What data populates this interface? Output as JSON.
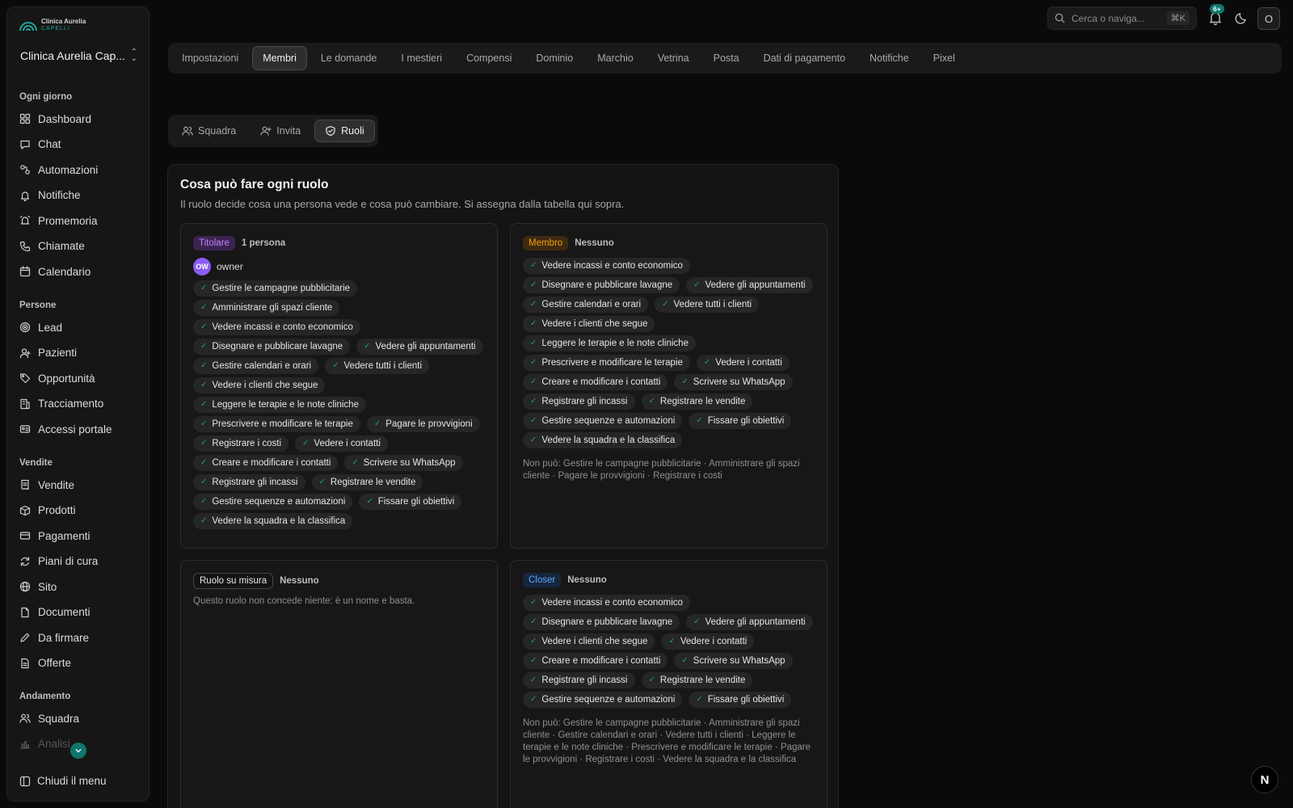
{
  "brand": {
    "line1": "Clinica Aurelia",
    "line2": "CAPELLI"
  },
  "workspace": {
    "name": "Clinica Aurelia Cap..."
  },
  "sidebar": {
    "sections": [
      {
        "label": "Ogni giorno",
        "items": [
          {
            "label": "Dashboard",
            "icon": "dashboard-icon"
          },
          {
            "label": "Chat",
            "icon": "chat-icon"
          },
          {
            "label": "Automazioni",
            "icon": "automation-icon"
          },
          {
            "label": "Notifiche",
            "icon": "bell-icon"
          },
          {
            "label": "Promemoria",
            "icon": "alarm-icon"
          },
          {
            "label": "Chiamate",
            "icon": "phone-icon"
          },
          {
            "label": "Calendario",
            "icon": "calendar-icon"
          }
        ]
      },
      {
        "label": "Persone",
        "items": [
          {
            "label": "Lead",
            "icon": "target-icon"
          },
          {
            "label": "Pazienti",
            "icon": "user-icon"
          },
          {
            "label": "Opportunità",
            "icon": "tag-icon"
          },
          {
            "label": "Tracciamento",
            "icon": "building-icon"
          },
          {
            "label": "Accessi portale",
            "icon": "id-card-icon"
          }
        ]
      },
      {
        "label": "Vendite",
        "items": [
          {
            "label": "Vendite",
            "icon": "receipt-icon"
          },
          {
            "label": "Prodotti",
            "icon": "box-icon"
          },
          {
            "label": "Pagamenti",
            "icon": "credit-card-icon"
          },
          {
            "label": "Piani di cura",
            "icon": "refresh-icon"
          },
          {
            "label": "Sito",
            "icon": "globe-icon"
          },
          {
            "label": "Documenti",
            "icon": "document-icon"
          },
          {
            "label": "Da firmare",
            "icon": "pen-icon"
          },
          {
            "label": "Offerte",
            "icon": "file-icon"
          }
        ]
      },
      {
        "label": "Andamento",
        "items": [
          {
            "label": "Squadra",
            "icon": "users-icon"
          },
          {
            "label": "Analisi",
            "icon": "chart-icon"
          }
        ]
      }
    ],
    "close_menu": "Chiudi il menu"
  },
  "topbar": {
    "search_placeholder": "Cerca o naviga...",
    "shortcut": "⌘K",
    "notif_badge": "6+",
    "user_initial": "O"
  },
  "tabs": [
    "Impostazioni",
    "Membri",
    "Le domande",
    "I mestieri",
    "Compensi",
    "Dominio",
    "Marchio",
    "Vetrina",
    "Posta",
    "Dati di pagamento",
    "Notifiche",
    "Pixel"
  ],
  "active_tab": "Membri",
  "subtabs": [
    {
      "label": "Squadra",
      "icon": "users-icon"
    },
    {
      "label": "Invita",
      "icon": "user-plus-icon"
    },
    {
      "label": "Ruoli",
      "icon": "shield-icon"
    }
  ],
  "active_subtab": "Ruoli",
  "panel": {
    "title": "Cosa può fare ogni ruolo",
    "subtitle": "Il ruolo decide cosa una persona vede e cosa può cambiare. Si assegna dalla tabella qui sopra."
  },
  "roles": {
    "titolare": {
      "name": "Titolare",
      "count": "1 persona",
      "owner_initials": "OW",
      "owner_name": "owner",
      "color": "#c084fc",
      "bg": "#3b2450",
      "perms": [
        "Gestire le campagne pubblicitarie",
        "Amministrare gli spazi cliente",
        "Vedere incassi e conto economico",
        "Disegnare e pubblicare lavagne",
        "Vedere gli appuntamenti",
        "Gestire calendari e orari",
        "Vedere tutti i clienti",
        "Vedere i clienti che segue",
        "Leggere le terapie e le note cliniche",
        "Prescrivere e modificare le terapie",
        "Pagare le provvigioni",
        "Registrare i costi",
        "Vedere i contatti",
        "Creare e modificare i contatti",
        "Scrivere su WhatsApp",
        "Registrare gli incassi",
        "Registrare le vendite",
        "Gestire sequenze e automazioni",
        "Fissare gli obiettivi",
        "Vedere la squadra e la classifica"
      ]
    },
    "membro": {
      "name": "Membro",
      "count": "Nessuno",
      "color": "#f59e0b",
      "bg": "#3d2a10",
      "perms": [
        "Vedere incassi e conto economico",
        "Disegnare e pubblicare lavagne",
        "Vedere gli appuntamenti",
        "Gestire calendari e orari",
        "Vedere tutti i clienti",
        "Vedere i clienti che segue",
        "Leggere le terapie e le note cliniche",
        "Prescrivere e modificare le terapie",
        "Vedere i contatti",
        "Creare e modificare i contatti",
        "Scrivere su WhatsApp",
        "Registrare gli incassi",
        "Registrare le vendite",
        "Gestire sequenze e automazioni",
        "Fissare gli obiettivi",
        "Vedere la squadra e la classifica"
      ],
      "cannot": "Non può: Gestire le campagne pubblicitarie · Amministrare gli spazi cliente · Pagare le provvigioni · Registrare i costi"
    },
    "custom": {
      "name": "Ruolo su misura",
      "count": "Nessuno",
      "note": "Questo ruolo non concede niente: è un nome e basta."
    },
    "closer": {
      "name": "Closer",
      "count": "Nessuno",
      "color": "#60a5fa",
      "bg": "#16263d",
      "perms": [
        "Vedere incassi e conto economico",
        "Disegnare e pubblicare lavagne",
        "Vedere gli appuntamenti",
        "Vedere i clienti che segue",
        "Vedere i contatti",
        "Creare e modificare i contatti",
        "Scrivere su WhatsApp",
        "Registrare gli incassi",
        "Registrare le vendite",
        "Gestire sequenze e automazioni",
        "Fissare gli obiettivi"
      ],
      "cannot": "Non può: Gestire le campagne pubblicitarie · Amministrare gli spazi cliente · Gestire calendari e orari · Vedere tutti i clienti · Leggere le terapie e le note cliniche · Prescrivere e modificare le terapie · Pagare le provvigioni · Registrare i costi · Vedere la squadra e la classifica"
    }
  },
  "corner_badge": "N"
}
